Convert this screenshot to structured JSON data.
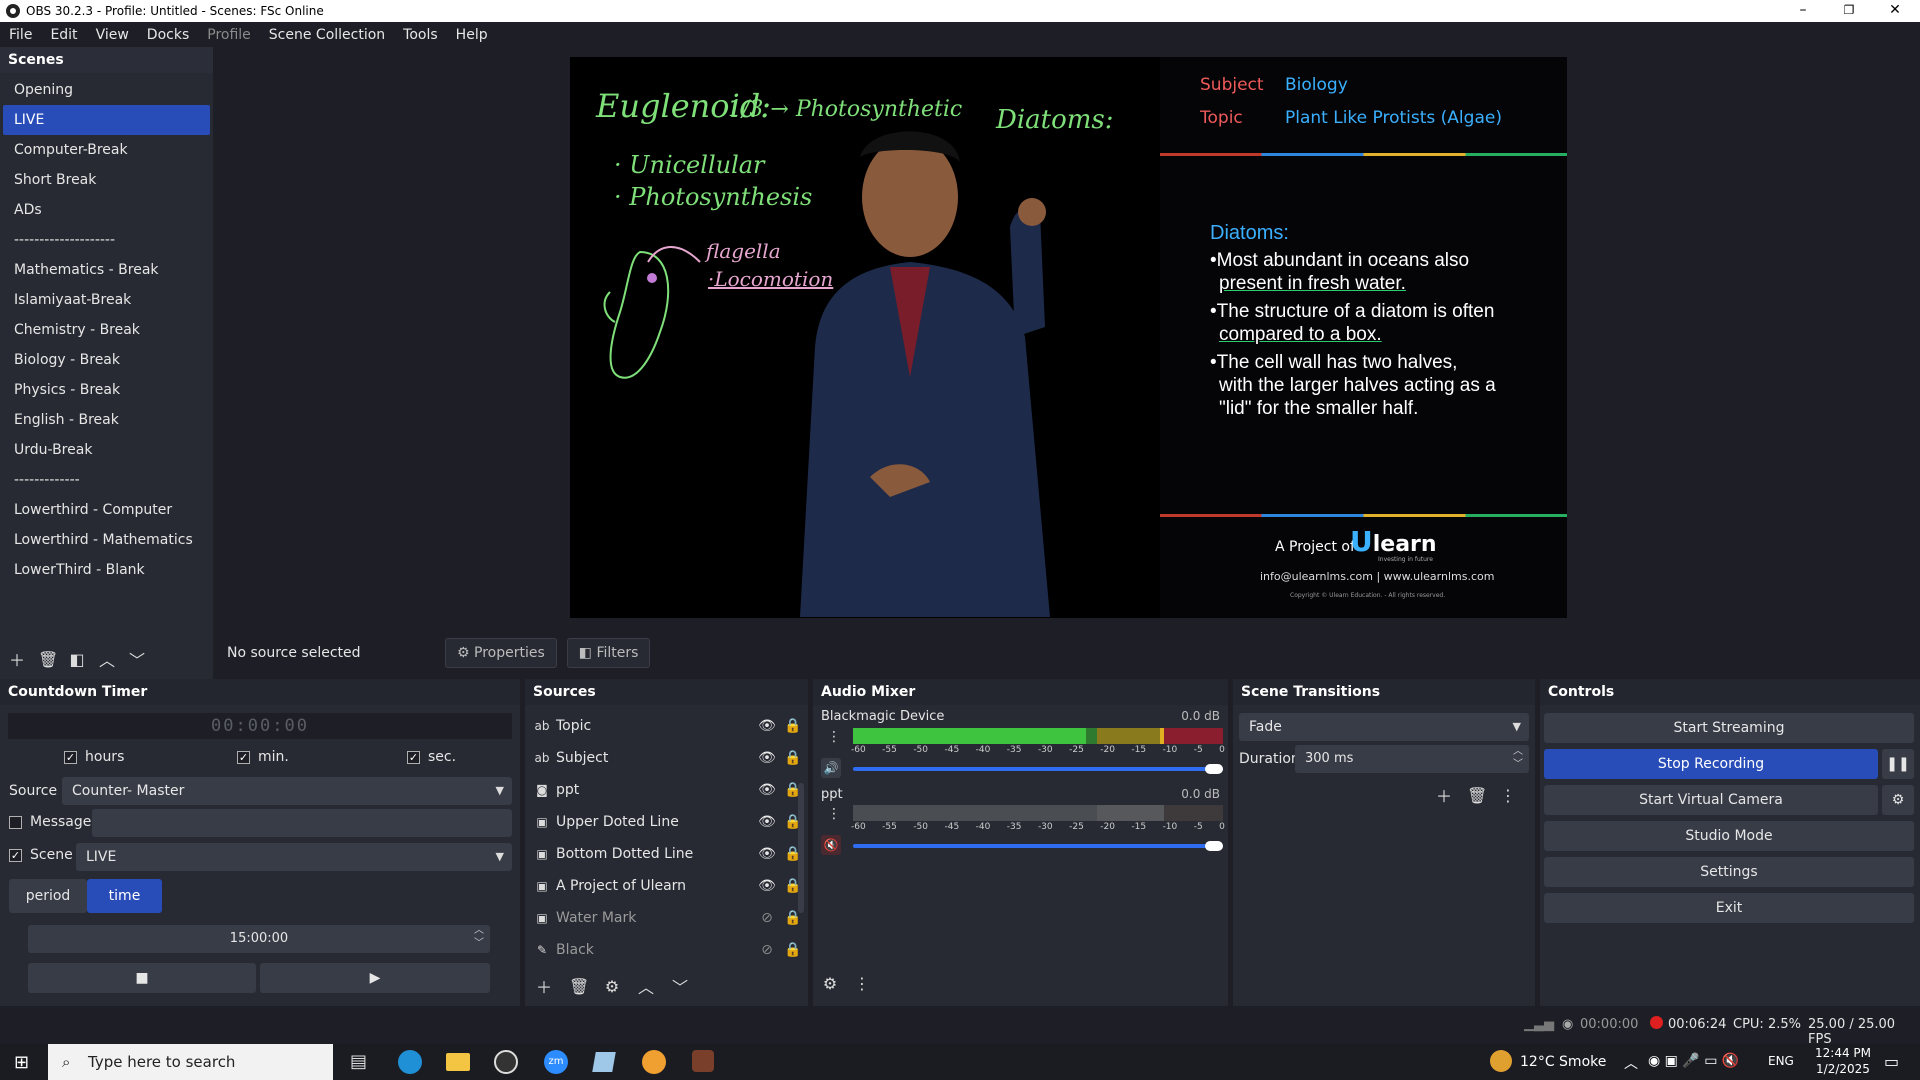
{
  "window": {
    "title": "OBS 30.2.3 - Profile: Untitled - Scenes: FSc Online",
    "minimize": "–",
    "restore": "❐",
    "close": "✕"
  },
  "menu": [
    "File",
    "Edit",
    "View",
    "Docks",
    "Profile",
    "Scene Collection",
    "Tools",
    "Help"
  ],
  "scenes": {
    "title": "Scenes",
    "items": [
      "Opening",
      "LIVE",
      "Computer-Break",
      "Short Break",
      "ADs",
      "--------------------",
      "Mathematics  - Break",
      "Islamiyaat-Break",
      "Chemistry  - Break",
      "Biology  - Break",
      "Physics  - Break",
      "English - Break",
      "Urdu-Break",
      "-------------",
      "Lowerthird - Computer",
      "Lowerthird - Mathematics",
      "LowerThird - Blank"
    ],
    "active": "LIVE"
  },
  "preview": {
    "subject_label": "Subject",
    "subject_value": "Biology",
    "topic_label": "Topic",
    "topic_value": "Plant Like Protists (Algae)",
    "chalk_title": "Euglenoid:",
    "chalk_fraction": "1/3 → Photosynthetic",
    "chalk_diatoms": "Diatoms:",
    "chalk_unicellular": "· Unicellular",
    "chalk_photosynthesis": "· Photosynthesis",
    "chalk_flagella": "flagella",
    "chalk_locomotion": "·Locomotion",
    "diatom_heading": "Diatoms:",
    "diatom_point1": "•Most abundant in oceans also",
    "diatom_point1b": "present in fresh water.",
    "diatom_point2": "•The structure of a diatom is often",
    "diatom_point2b": "compared to a box.",
    "diatom_point3": "•The cell wall has two halves,",
    "diatom_point3b": "with the larger halves acting as a",
    "diatom_point3c": "\"lid\" for the smaller half.",
    "project_of": "A Project of",
    "brand": "learn",
    "brand_u": "U",
    "brand_tagline": "Investing in future",
    "contact": "info@ulearnlms.com | www.ulearnlms.com",
    "copyright": "Copyright © Ulearn Education. - All rights reserved."
  },
  "context": {
    "no_source": "No source selected",
    "properties": "Properties",
    "filters": "Filters"
  },
  "countdown": {
    "title": "Countdown Timer",
    "display": "00:00:00",
    "hours": "hours",
    "min": "min.",
    "sec": "sec.",
    "source_label": "Source",
    "source_value": "Counter- Master",
    "message_label": "Message",
    "scene_label": "Scene",
    "scene_value": "LIVE",
    "period": "period",
    "time": "time",
    "time_value": "15:00:00"
  },
  "sources": {
    "title": "Sources",
    "items": [
      {
        "icon": "ab",
        "name": "Topic",
        "visible": true
      },
      {
        "icon": "▣",
        "name": "Subject",
        "visible": true
      },
      {
        "icon": "◙",
        "name": "ppt",
        "visible": true
      },
      {
        "icon": "▣",
        "name": "Upper Doted Line",
        "visible": true
      },
      {
        "icon": "▣",
        "name": "Bottom Dotted Line",
        "visible": true
      },
      {
        "icon": "▣",
        "name": "A Project of Ulearn",
        "visible": true
      },
      {
        "icon": "▣",
        "name": "Water Mark",
        "visible": false
      },
      {
        "icon": "✎",
        "name": "Black",
        "visible": false
      }
    ]
  },
  "mixer": {
    "title": "Audio Mixer",
    "ch1_name": "Blackmagic Device",
    "ch1_db": "0.0 dB",
    "ch2_name": "ppt",
    "ch2_db": "0.0 dB",
    "scale": [
      "-60",
      "-55",
      "-50",
      "-45",
      "-40",
      "-35",
      "-30",
      "-25",
      "-20",
      "-15",
      "-10",
      "-5",
      "0"
    ]
  },
  "transitions": {
    "title": "Scene Transitions",
    "type": "Fade",
    "duration_label": "Duration",
    "duration_value": "300 ms"
  },
  "controls": {
    "title": "Controls",
    "start_streaming": "Start Streaming",
    "stop_recording": "Stop Recording",
    "start_virtual_camera": "Start Virtual Camera",
    "studio_mode": "Studio Mode",
    "settings": "Settings",
    "exit": "Exit"
  },
  "status": {
    "stream_time": "00:00:00",
    "rec_time": "00:06:24",
    "cpu": "CPU: 2.5%",
    "fps": "25.00 / 25.00 FPS"
  },
  "taskbar": {
    "search_placeholder": "Type here to search",
    "weather": "12°C  Smoke",
    "lang": "ENG",
    "time": "12:44 PM",
    "date": "1/2/2025"
  },
  "colors": {
    "accent": "#284cb8",
    "record": "#e02020"
  }
}
